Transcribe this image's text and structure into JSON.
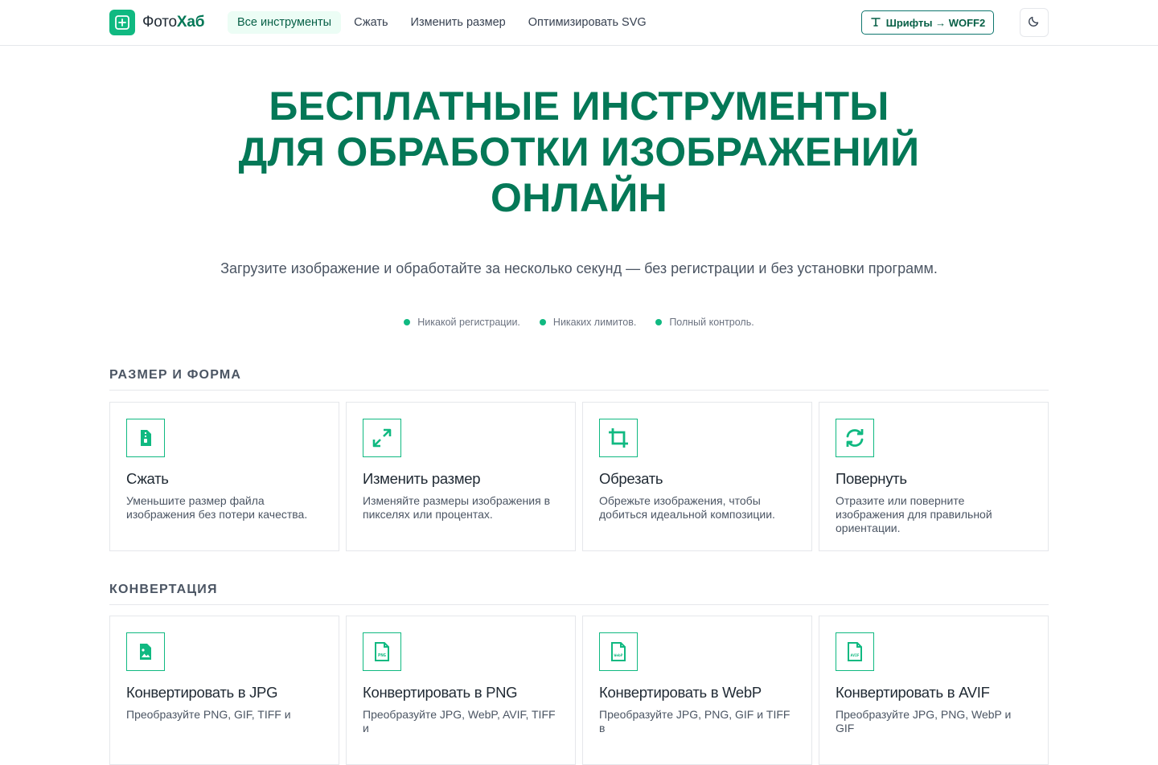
{
  "header": {
    "logo": {
      "part1": "Фото",
      "part2": "Хаб"
    },
    "nav": [
      {
        "label": "Все инструменты",
        "active": true
      },
      {
        "label": "Сжать",
        "active": false
      },
      {
        "label": "Изменить размер",
        "active": false
      },
      {
        "label": "Оптимизировать SVG",
        "active": false
      }
    ],
    "fonts_button": "Шрифты → WOFF2",
    "theme_icon": "moon-icon"
  },
  "hero": {
    "title_line1": "БЕСПЛАТНЫЕ ИНСТРУМЕНТЫ",
    "title_line2": "ДЛЯ ОБРАБОТКИ ИЗОБРАЖЕНИЙ",
    "title_line3": "ОНЛАЙН",
    "subtitle": "Загрузите изображение и обработайте за несколько секунд — без регистрации и без установки программ.",
    "bullets": [
      "Никакой регистрации.",
      "Никаких лимитов.",
      "Полный контроль."
    ]
  },
  "sections": [
    {
      "title": "РАЗМЕР И ФОРМА",
      "cards": [
        {
          "icon": "file-zip-icon",
          "title": "Сжать",
          "desc": "Уменьшите размер файла изображения без потери качества."
        },
        {
          "icon": "resize-arrows-icon",
          "title": "Изменить размер",
          "desc": "Изменяйте размеры изображения в пикселях или процентах."
        },
        {
          "icon": "crop-icon",
          "title": "Обрезать",
          "desc": "Обрежьте изображения, чтобы добиться идеальной композиции."
        },
        {
          "icon": "rotate-icon",
          "title": "Повернуть",
          "desc": "Отразите или поверните изображения для правильной ориентации."
        }
      ]
    },
    {
      "title": "КОНВЕРТАЦИЯ",
      "cards": [
        {
          "icon": "file-image-icon",
          "title": "Конвертировать в JPG",
          "desc": "Преобразуйте PNG, GIF, TIFF и"
        },
        {
          "icon": "file-png-icon",
          "title": "Конвертировать в PNG",
          "desc": "Преобразуйте JPG, WebP, AVIF, TIFF и"
        },
        {
          "icon": "file-webp-icon",
          "title": "Конвертировать в WebP",
          "desc": "Преобразуйте JPG, PNG, GIF и TIFF в"
        },
        {
          "icon": "file-avif-icon",
          "title": "Конвертировать в AVIF",
          "desc": "Преобразуйте JPG, PNG, WebP и GIF"
        }
      ]
    }
  ],
  "colors": {
    "accent": "#10b981",
    "brand_dark": "#047857",
    "nav_active_bg": "#ecfdf5"
  }
}
